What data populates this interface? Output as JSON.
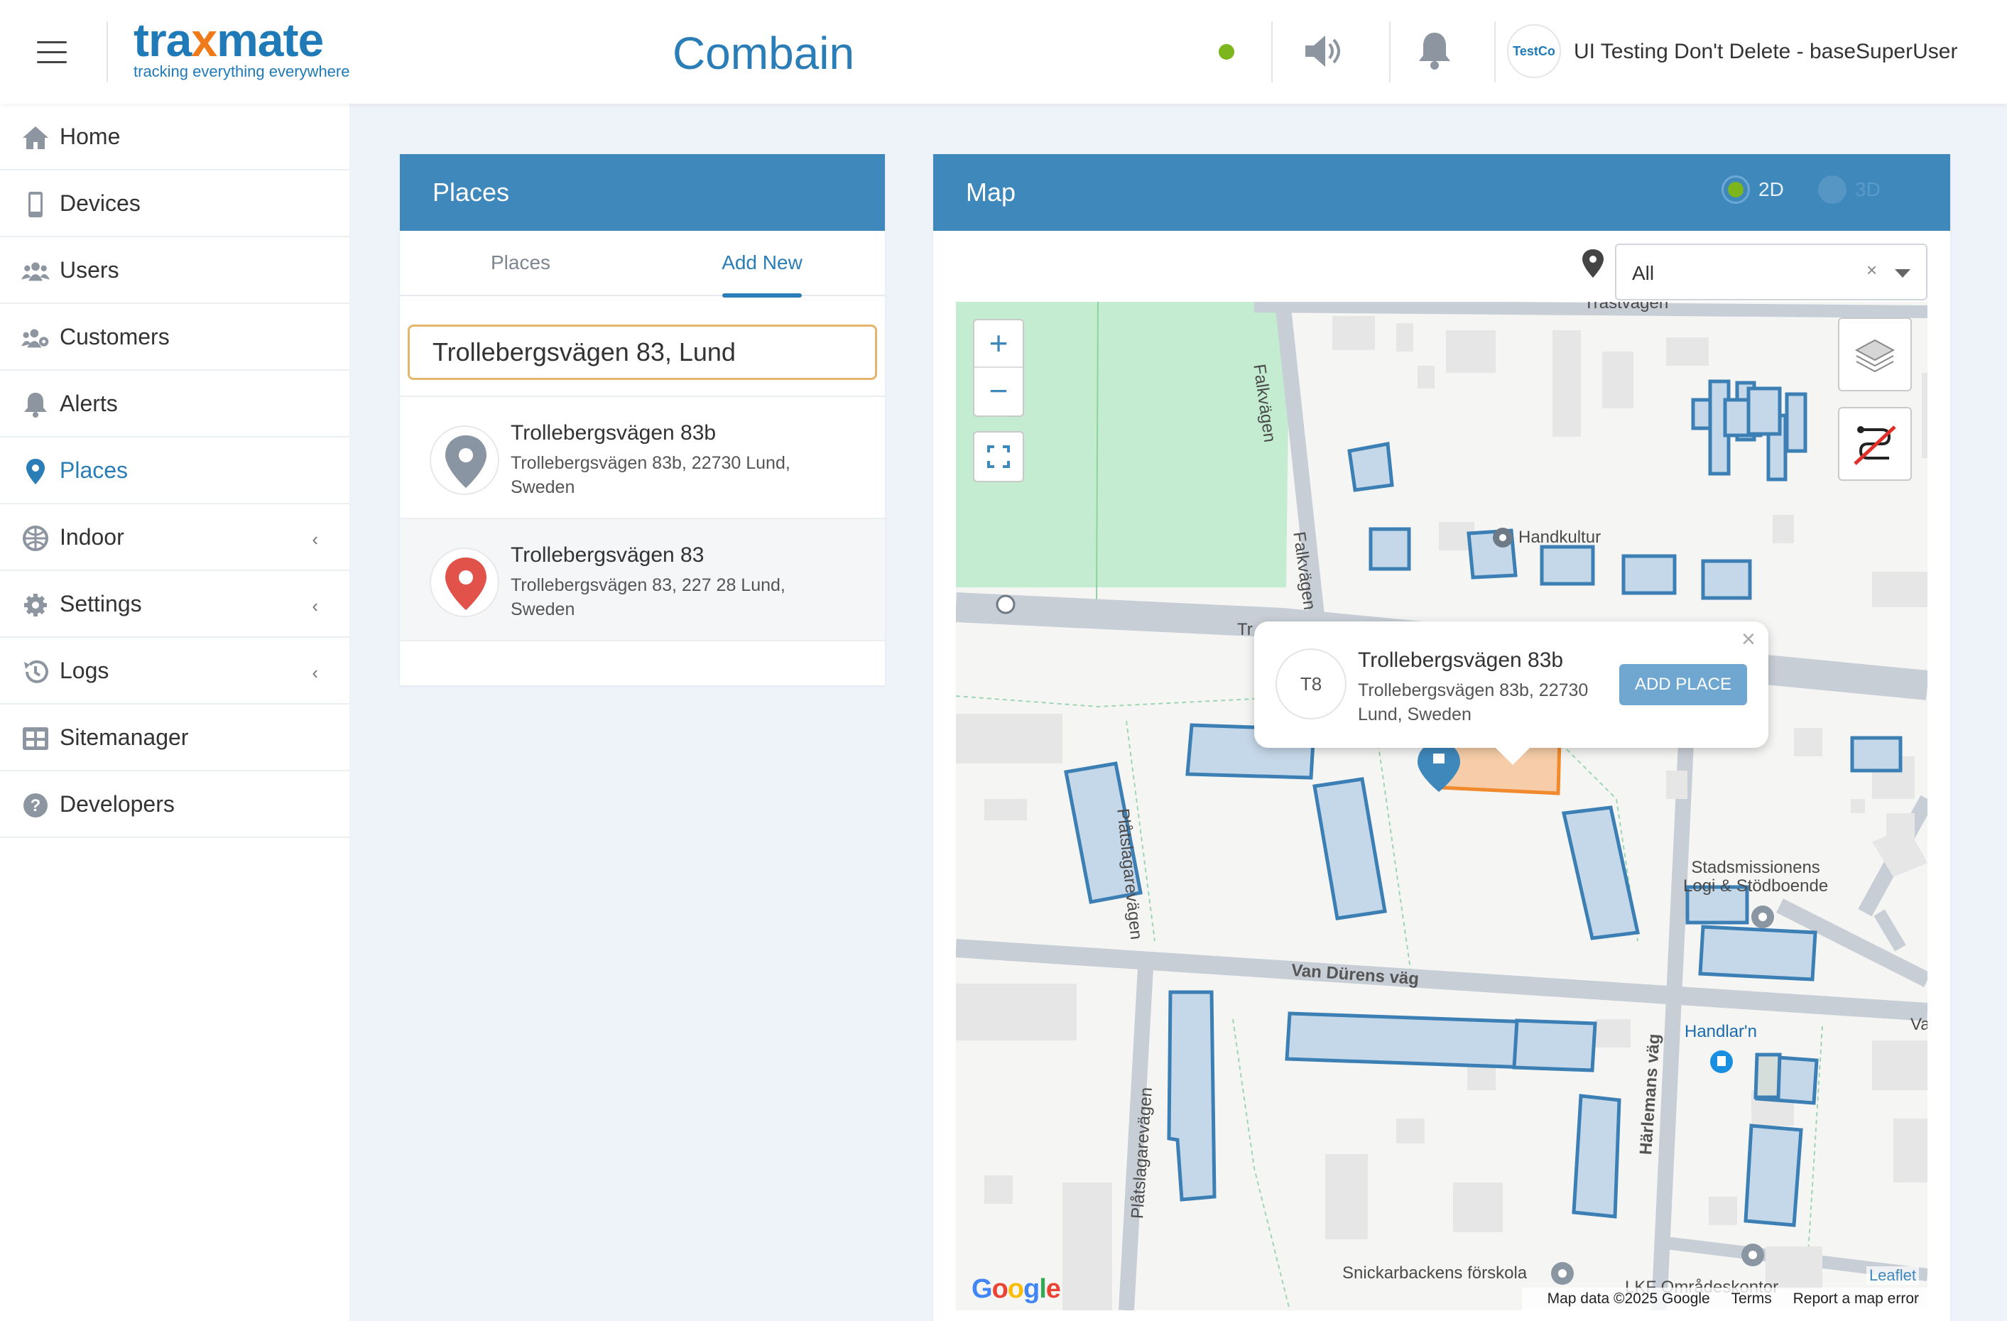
{
  "header": {
    "logo": {
      "part1": "tra",
      "x": "x",
      "part2": "mate",
      "tagline": "tracking everything everywhere"
    },
    "app_title": "Combain",
    "icons": [
      "menu-icon",
      "status-dot",
      "speaker-icon",
      "bell-icon"
    ],
    "avatar_text": "TestCo",
    "user_name": "UI Testing Don't Delete - baseSuperUser"
  },
  "sidebar": {
    "items": [
      {
        "label": "Home",
        "icon": "home-icon"
      },
      {
        "label": "Devices",
        "icon": "device-icon"
      },
      {
        "label": "Users",
        "icon": "users-icon"
      },
      {
        "label": "Customers",
        "icon": "customers-icon"
      },
      {
        "label": "Alerts",
        "icon": "bell-icon"
      },
      {
        "label": "Places",
        "icon": "pin-icon",
        "active": true
      },
      {
        "label": "Indoor",
        "icon": "globe-icon",
        "chevron": "‹"
      },
      {
        "label": "Settings",
        "icon": "gear-icon",
        "chevron": "‹"
      },
      {
        "label": "Logs",
        "icon": "history-icon",
        "chevron": "‹"
      },
      {
        "label": "Sitemanager",
        "icon": "grid-icon"
      },
      {
        "label": "Developers",
        "icon": "help-icon"
      }
    ]
  },
  "places_panel": {
    "title": "Places",
    "tabs": [
      {
        "label": "Places"
      },
      {
        "label": "Add New",
        "active": true
      }
    ],
    "search_value": "Trollebergsvägen 83, Lund",
    "results": [
      {
        "title": "Trollebergsvägen 83b",
        "subtitle": "Trollebergsvägen 83b, 22730 Lund, Sweden",
        "pin_color": "#8a95a3"
      },
      {
        "title": "Trollebergsvägen 83",
        "subtitle": "Trollebergsvägen 83, 227 28 Lund, Sweden",
        "pin_color": "#e0524a",
        "selected": true
      }
    ]
  },
  "map_panel": {
    "title": "Map",
    "mode_2d": "2D",
    "mode_3d": "3D",
    "filter_value": "All",
    "filter_clear": "×",
    "zoom_in": "+",
    "zoom_out": "−",
    "labels": {
      "street_top": "Trastvägen",
      "falkvagen_1": "Falkvägen",
      "falkvagen_2": "Falkvägen",
      "handkultur": "Handkultur",
      "platslagare_1": "Plåtslagarevägen",
      "platslagare_2": "Plåtslagarevägen",
      "van_durens": "Van Dürens väg",
      "stadsmissionen": "Stadsmissionens\nLogi & Stödboende",
      "handlarn": "Handlar'n",
      "harlemans": "Härlemans väg",
      "snickarbacken": "Snickarbackens förskola",
      "lkf": "LKF Områdeskontor",
      "tr": "Tr",
      "va": "Va"
    },
    "popup": {
      "avatar": "T8",
      "title": "Trollebergsvägen 83b",
      "subtitle": "Trollebergsvägen 83b, 22730 Lund, Sweden",
      "button": "ADD PLACE",
      "close": "×"
    },
    "attribution": {
      "data": "Map data ©2025 Google",
      "terms": "Terms",
      "report": "Report a map error",
      "leaflet": "Leaflet",
      "google": "Google"
    }
  },
  "colors": {
    "header_bar": "#3f88bb",
    "accent": "#2a7db6",
    "status_green": "#7cb51c",
    "logo_orange": "#f07a1a",
    "building_fill": "#c5d8ea",
    "building_stroke": "#3b7fb4",
    "highlight": "#f08a2c"
  }
}
